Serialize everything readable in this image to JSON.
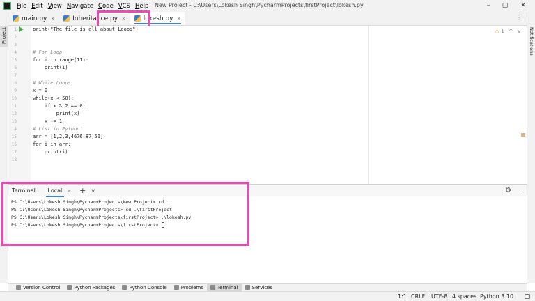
{
  "menu": [
    "File",
    "Edit",
    "View",
    "Navigate",
    "Code",
    "VCS",
    "Help"
  ],
  "window_title": "New Project - C:\\Users\\Lokesh Singh\\PycharmProjects\\firstProject\\lokesh.py",
  "window_controls": [
    "–",
    "▢",
    "✕"
  ],
  "side": {
    "project_label": "Project",
    "notifications_label": "Notifications"
  },
  "tabs": [
    {
      "label": "main.py",
      "icon": "python-file-icon",
      "active": false
    },
    {
      "label": "Inheritance.py",
      "icon": "python-file-icon",
      "active": false
    },
    {
      "label": "lokesh.py",
      "icon": "python-file-icon",
      "active": true
    }
  ],
  "tab_menu": "⋮",
  "editor": {
    "line_numbers": [
      "1",
      "2",
      "3",
      "4",
      "5",
      "6",
      "7",
      "8",
      "9",
      "10",
      "11",
      "12",
      "13",
      "14",
      "15",
      "16",
      "17",
      "18"
    ],
    "lines": [
      "print(\"The file is all about Loops\")",
      "",
      "",
      "# For Loop",
      "for i in range(11):",
      "    print(i)",
      "",
      "# While Loops",
      "x = 0",
      "while(x < 50):",
      "    if x % 2 == 0:",
      "        print(x)",
      "    x += 1",
      "# List in Python",
      "arr = [1,2,3,4676,87,56]",
      "for i in arr:",
      "    print(i)",
      ""
    ],
    "inspection": {
      "warnings": "1",
      "up": "^",
      "down": "v"
    }
  },
  "terminal": {
    "title": "Terminal:",
    "tab": "Local",
    "tab_close": "×",
    "add": "+",
    "dropdown": "v",
    "settings": "⚙",
    "minimize": "–",
    "lines": [
      "PS C:\\Users\\Lokesh Singh\\PycharmProjects\\New Project> cd ..",
      "PS C:\\Users\\Lokesh Singh\\PycharmProjects> cd .\\firstProject",
      "PS C:\\Users\\Lokesh Singh\\PycharmProjects\\firstProject> .\\lokesh.py",
      "PS C:\\Users\\Lokesh Singh\\PycharmProjects\\firstProject> "
    ]
  },
  "tool_windows": [
    {
      "label": "Version Control",
      "icon": "version-control-icon",
      "active": false
    },
    {
      "label": "Python Packages",
      "icon": "packages-icon",
      "active": false
    },
    {
      "label": "Python Console",
      "icon": "python-console-icon",
      "active": false
    },
    {
      "label": "Problems",
      "icon": "problems-icon",
      "active": false
    },
    {
      "label": "Terminal",
      "icon": "terminal-icon",
      "active": true
    },
    {
      "label": "Services",
      "icon": "services-icon",
      "active": false
    }
  ],
  "status": {
    "position": "1:1",
    "line_separator": "CRLF",
    "encoding": "UTF-8",
    "indent": "4 spaces",
    "interpreter": "Python 3.10"
  },
  "colors": {
    "highlight": "#ec49b5",
    "accent": "#4083c9",
    "run": "#4caf50",
    "keyword": "#0033b3",
    "number": "#1750eb",
    "string": "#067d17",
    "comment": "#8c8c8c"
  }
}
